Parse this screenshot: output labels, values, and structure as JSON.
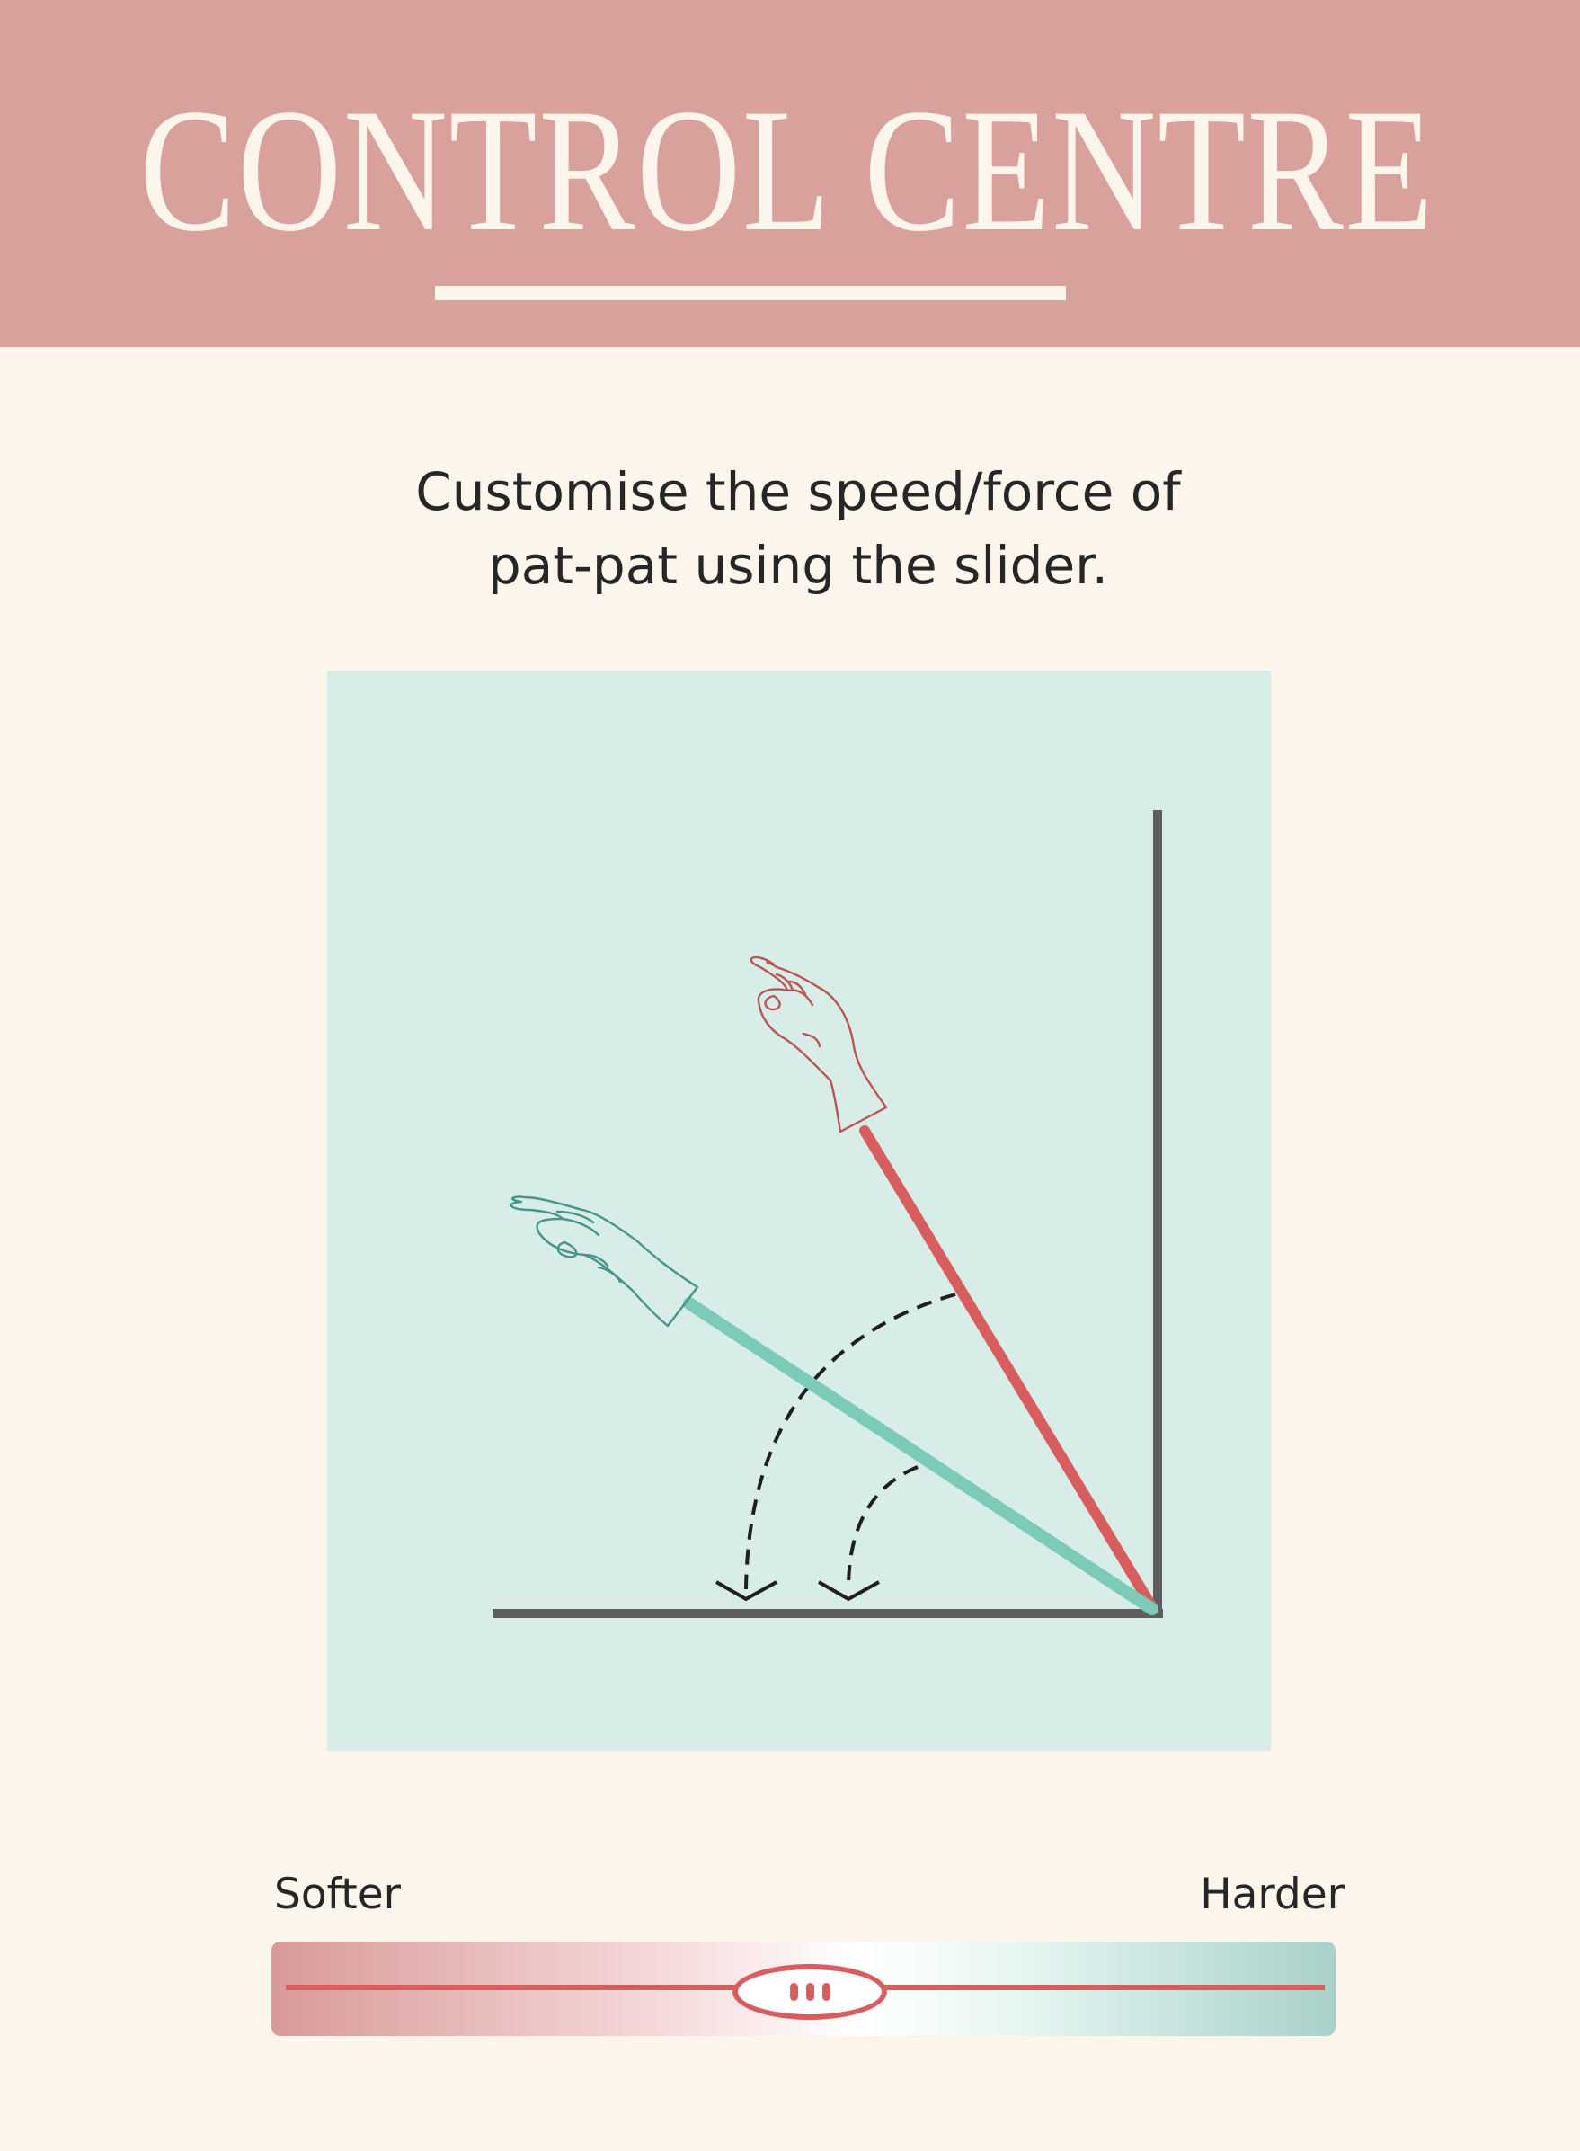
{
  "header": {
    "title": "CONTROL CENTRE"
  },
  "instruction": {
    "line1": "Customise the speed/force of",
    "line2": "pat-pat using the slider."
  },
  "illustration": {
    "icons": [
      "raised-hand-icon-soft",
      "raised-hand-icon-hard",
      "swing-arrow-icon"
    ]
  },
  "slider": {
    "left_label": "Softer",
    "right_label": "Harder",
    "value_fraction": 0.5
  },
  "colors": {
    "header_bg": "#d9a19b",
    "page_bg": "#fcf5ec",
    "panel_bg": "#d8ede7",
    "arm_hard": "#d85d5e",
    "arm_soft": "#7ccbb8",
    "axis": "#5e5e5e"
  }
}
